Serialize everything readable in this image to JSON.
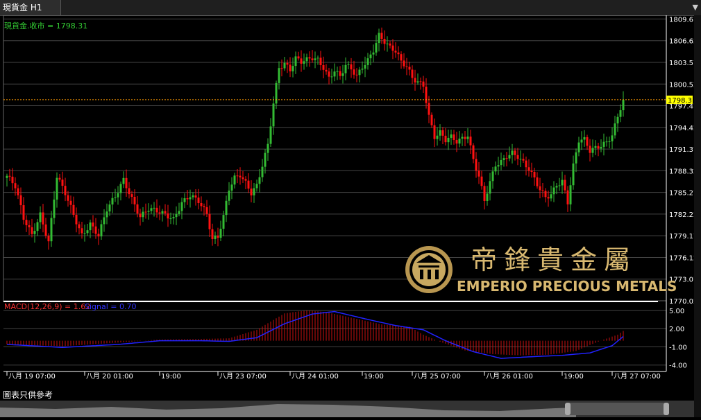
{
  "tab": {
    "title": "現貨金 H1",
    "menu_icon": "dropdown-arrow-icon"
  },
  "price_label": "現貨金.收市 = 1798.31",
  "current_price": "1798.31",
  "macd_label": "MACD(12,26,9) = 1.62",
  "signal_label": "Signal = 0.70",
  "footer": "圖表只供參考",
  "logo": {
    "brand_cn": "帝鋒貴金屬",
    "brand_en": "EMPERIO PRECIOUS METALS"
  },
  "colors": {
    "up": "#33bb33",
    "down": "#ff1111",
    "price_line": "#ff9900",
    "signal": "#2222ff",
    "macd_label": "#ff3333",
    "price_label": "#33cc33",
    "axis_text": "#ffffff",
    "grid": "#444444"
  },
  "chart_data": {
    "type": "candlestick",
    "series_name": "現貨金.收市",
    "price_axis": {
      "ticks": [
        "1809.67",
        "1806.62",
        "1803.57",
        "1800.52",
        "1797.47",
        "1794.42",
        "1791.37",
        "1788.32",
        "1785.27",
        "1782.22",
        "1779.17",
        "1776.12",
        "1773.07",
        "1770.02"
      ],
      "range": [
        1770.02,
        1810.2
      ]
    },
    "macd_axis": {
      "ticks": [
        "5.00",
        "2.00",
        "-1.00",
        "-4.00"
      ],
      "range": [
        -4.0,
        5.0
      ]
    },
    "x_labels": [
      "八月 19 07:00",
      "八月 20 01:00",
      "19:00",
      "八月 23 07:00",
      "八月 24 01:00",
      "19:00",
      "八月 25 07:00",
      "八月 26 01:00",
      "19:00",
      "八月 27 07:00"
    ],
    "close_anchors": [
      [
        0,
        1787.6
      ],
      [
        3,
        1786.0
      ],
      [
        6,
        1781.5
      ],
      [
        9,
        1779.3
      ],
      [
        12,
        1782.3
      ],
      [
        15,
        1778.4
      ],
      [
        18,
        1787.5
      ],
      [
        21,
        1785.0
      ],
      [
        24,
        1782.0
      ],
      [
        27,
        1779.3
      ],
      [
        30,
        1781.0
      ],
      [
        33,
        1779.3
      ],
      [
        36,
        1782.8
      ],
      [
        39,
        1784.5
      ],
      [
        42,
        1787.0
      ],
      [
        45,
        1784.5
      ],
      [
        48,
        1782.0
      ],
      [
        51,
        1783.0
      ],
      [
        54,
        1782.5
      ],
      [
        57,
        1782.0
      ],
      [
        60,
        1781.5
      ],
      [
        63,
        1784.0
      ],
      [
        66,
        1785.0
      ],
      [
        69,
        1784.0
      ],
      [
        72,
        1782.0
      ],
      [
        74,
        1778.5
      ],
      [
        76,
        1779.0
      ],
      [
        78,
        1782.0
      ],
      [
        80,
        1786.0
      ],
      [
        82,
        1787.5
      ],
      [
        84,
        1787.8
      ],
      [
        86,
        1786.5
      ],
      [
        88,
        1785.0
      ],
      [
        90,
        1786.0
      ],
      [
        92,
        1789.0
      ],
      [
        94,
        1792.0
      ],
      [
        96,
        1798.0
      ],
      [
        98,
        1803.0
      ],
      [
        100,
        1803.5
      ],
      [
        102,
        1802.5
      ],
      [
        104,
        1804.0
      ],
      [
        106,
        1803.5
      ],
      [
        108,
        1803.8
      ],
      [
        110,
        1804.2
      ],
      [
        112,
        1804.0
      ],
      [
        114,
        1803.0
      ],
      [
        116,
        1801.5
      ],
      [
        118,
        1802.5
      ],
      [
        120,
        1801.5
      ],
      [
        122,
        1803.0
      ],
      [
        124,
        1802.5
      ],
      [
        126,
        1801.5
      ],
      [
        128,
        1803.0
      ],
      [
        130,
        1804.0
      ],
      [
        132,
        1805.5
      ],
      [
        134,
        1807.5
      ],
      [
        136,
        1806.5
      ],
      [
        138,
        1805.5
      ],
      [
        140,
        1805.0
      ],
      [
        142,
        1803.5
      ],
      [
        144,
        1803.0
      ],
      [
        146,
        1801.5
      ],
      [
        148,
        1801.0
      ],
      [
        150,
        1800.5
      ],
      [
        152,
        1796.0
      ],
      [
        154,
        1793.0
      ],
      [
        156,
        1793.5
      ],
      [
        158,
        1792.5
      ],
      [
        160,
        1793.0
      ],
      [
        162,
        1792.5
      ],
      [
        164,
        1793.0
      ],
      [
        166,
        1793.5
      ],
      [
        168,
        1790.0
      ],
      [
        170,
        1787.5
      ],
      [
        172,
        1784.0
      ],
      [
        174,
        1786.5
      ],
      [
        176,
        1789.0
      ],
      [
        178,
        1789.5
      ],
      [
        180,
        1790.5
      ],
      [
        182,
        1791.0
      ],
      [
        184,
        1790.5
      ],
      [
        186,
        1789.5
      ],
      [
        188,
        1788.5
      ],
      [
        190,
        1787.0
      ],
      [
        192,
        1785.5
      ],
      [
        194,
        1784.5
      ],
      [
        196,
        1785.0
      ],
      [
        198,
        1786.5
      ],
      [
        200,
        1787.0
      ],
      [
        202,
        1784.0
      ],
      [
        204,
        1789.0
      ],
      [
        206,
        1792.5
      ],
      [
        208,
        1792.5
      ],
      [
        210,
        1791.0
      ],
      [
        212,
        1791.5
      ],
      [
        214,
        1792.0
      ],
      [
        216,
        1792.5
      ],
      [
        218,
        1793.5
      ],
      [
        220,
        1796.0
      ],
      [
        222,
        1798.31
      ]
    ],
    "macd_anchors": [
      [
        0,
        -0.6
      ],
      [
        20,
        -0.9
      ],
      [
        40,
        -0.3
      ],
      [
        55,
        0.2
      ],
      [
        70,
        0.3
      ],
      [
        80,
        0.4
      ],
      [
        90,
        1.8
      ],
      [
        100,
        4.5
      ],
      [
        108,
        5.0
      ],
      [
        115,
        4.7
      ],
      [
        125,
        3.7
      ],
      [
        135,
        2.7
      ],
      [
        145,
        2.3
      ],
      [
        150,
        1.0
      ],
      [
        155,
        0.0
      ],
      [
        165,
        -1.6
      ],
      [
        175,
        -2.2
      ],
      [
        185,
        -2.4
      ],
      [
        195,
        -2.3
      ],
      [
        205,
        -1.7
      ],
      [
        210,
        -0.7
      ],
      [
        215,
        0.2
      ],
      [
        220,
        1.0
      ],
      [
        222,
        1.62
      ]
    ],
    "signal_anchors": [
      [
        0,
        -0.6
      ],
      [
        20,
        -1.1
      ],
      [
        40,
        -0.6
      ],
      [
        55,
        0.0
      ],
      [
        70,
        0.0
      ],
      [
        80,
        -0.1
      ],
      [
        90,
        0.5
      ],
      [
        100,
        2.8
      ],
      [
        110,
        4.4
      ],
      [
        118,
        4.8
      ],
      [
        130,
        3.5
      ],
      [
        140,
        2.5
      ],
      [
        150,
        1.8
      ],
      [
        158,
        0.0
      ],
      [
        168,
        -1.8
      ],
      [
        178,
        -2.9
      ],
      [
        190,
        -2.6
      ],
      [
        200,
        -2.4
      ],
      [
        210,
        -2.0
      ],
      [
        218,
        -0.8
      ],
      [
        222,
        0.7
      ]
    ]
  }
}
